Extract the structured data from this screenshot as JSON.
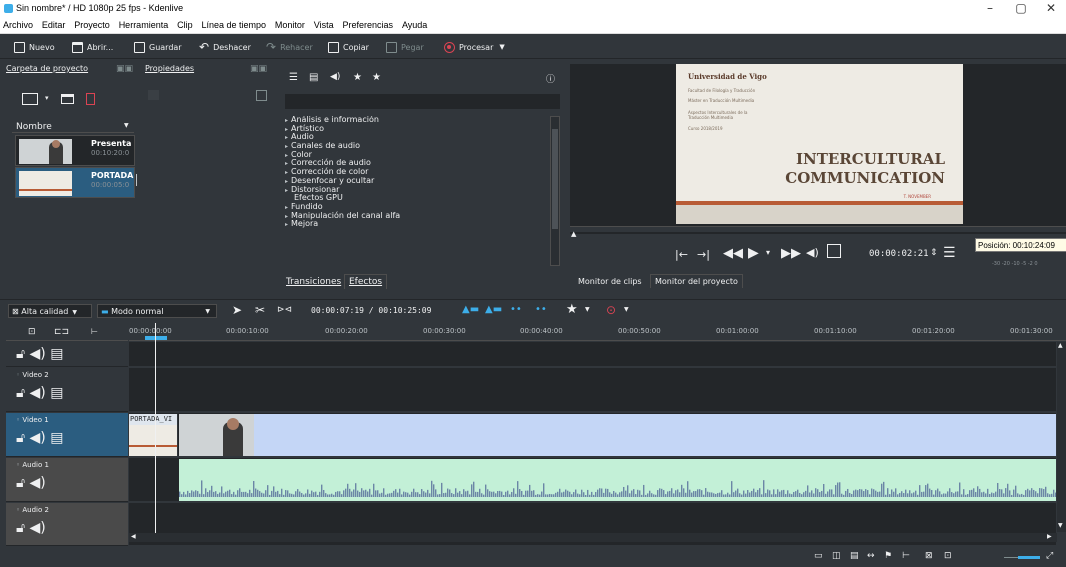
{
  "window": {
    "title": "Sin nombre* / HD 1080p 25 fps - Kdenlive",
    "controls": [
      "–",
      "▢",
      "✕"
    ]
  },
  "menubar": [
    "Archivo",
    "Editar",
    "Proyecto",
    "Herramienta",
    "Clip",
    "Línea de tiempo",
    "Monitor",
    "Vista",
    "Preferencias",
    "Ayuda"
  ],
  "toolbar": {
    "nuevo": "Nuevo",
    "abrir": "Abrir...",
    "guardar": "Guardar",
    "deshacer": "Deshacer",
    "rehacer": "Rehacer",
    "copiar": "Copiar",
    "pegar": "Pegar",
    "procesar": "Procesar"
  },
  "project_panel": {
    "tab_project": "Carpeta de proyecto",
    "tab_properties": "Propiedades",
    "column": "Nombre",
    "clips": [
      {
        "name": "Presenta",
        "duration": "00:10:20:0"
      },
      {
        "name": "PORTADA",
        "duration": "00:00:05:0"
      }
    ]
  },
  "effects_panel": {
    "items": [
      {
        "label": "Análisis e información",
        "arrow": true
      },
      {
        "label": "Artístico",
        "arrow": true
      },
      {
        "label": "Audio",
        "arrow": true
      },
      {
        "label": "Canales de audio",
        "arrow": true
      },
      {
        "label": "Color",
        "arrow": true
      },
      {
        "label": "Corrección de audio",
        "arrow": true
      },
      {
        "label": "Corrección de color",
        "arrow": true
      },
      {
        "label": "Desenfocar y ocultar",
        "arrow": true
      },
      {
        "label": "Distorsionar",
        "arrow": true
      },
      {
        "label": "Efectos GPU",
        "arrow": false
      },
      {
        "label": "Fundido",
        "arrow": true
      },
      {
        "label": "Manipulación del canal alfa",
        "arrow": true
      },
      {
        "label": "Mejora",
        "arrow": true
      }
    ],
    "tab_transitions": "Transiciones",
    "tab_effects": "Efectos"
  },
  "monitor": {
    "slide": {
      "university": "Universidad de Vigo",
      "line1": "Facultad de Filología y Traducción",
      "line2": "Máster en Traducción Multimedia",
      "line3": "Aspectos Interculturales de la",
      "line3b": "Traducción Multimedia",
      "line4": "Curso 2018/2019",
      "title1": "INTERCULTURAL",
      "title2": "COMMUNICATION",
      "author": "T. NOVEMBER"
    },
    "timecode": "00:00:02:21",
    "tooltip": "Posición: 00:10:24:09",
    "meter_labels": "-30 -20  -10 -5 -2 0",
    "tab_clip": "Monitor de clips",
    "tab_project": "Monitor del proyecto"
  },
  "timeline_toolbar": {
    "quality": "Alta calidad",
    "mode": "Modo normal",
    "position": "00:00:07:19 / 00:10:25:09"
  },
  "ruler": {
    "ticks": [
      "00:00:00:00",
      "00:00:10:00",
      "00:00:20:00",
      "00:00:30:00",
      "00:00:40:00",
      "00:00:50:00",
      "00:01:00:00",
      "00:01:10:00",
      "00:01:20:00",
      "00:01:30:00"
    ]
  },
  "tracks": [
    {
      "name": "",
      "type": "video"
    },
    {
      "name": "Video 2",
      "type": "video"
    },
    {
      "name": "Video 1",
      "type": "video"
    },
    {
      "name": "Audio 1",
      "type": "audio"
    },
    {
      "name": "Audio 2",
      "type": "audio"
    }
  ],
  "timeline_clips": {
    "portada_label": "PORTADA_VI"
  },
  "colors": {
    "bg": "#31363b",
    "panel_dark": "#232629",
    "accent": "#3daee9",
    "video_clip": "#c4d6f6",
    "audio_clip": "#c3f0d7",
    "waveform": "#6b86a6"
  }
}
